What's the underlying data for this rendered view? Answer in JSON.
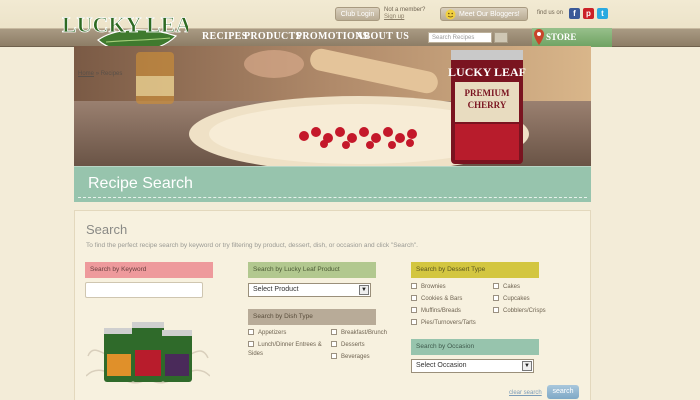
{
  "brand": {
    "logo_text": "LUCKY LEAF"
  },
  "header": {
    "club_login": "Club Login",
    "not_member": "Not a member?",
    "sign_up": "Sign up",
    "bloggers": "Meet Our Bloggers!",
    "find_us": "find us on"
  },
  "nav": {
    "items": [
      "RECIPES",
      "PRODUCTS",
      "PROMOTIONS",
      "ABOUT US"
    ],
    "search_placeholder": "Search Recipes",
    "store_locator": "STORE LOCATOR"
  },
  "hero": {
    "breadcrumb_home": "Home",
    "breadcrumb_sep": "»",
    "breadcrumb_current": "Recipes",
    "can_brand": "LUCKY LEAF",
    "can_label_1": "PREMIUM",
    "can_label_2": "CHERRY"
  },
  "page_title": "Recipe Search",
  "search": {
    "title": "Search",
    "intro": "To find the perfect recipe search by keyword or try filtering by product, dessert, dish, or occasion and click \"Search\".",
    "keyword": {
      "label": "Search by Keyword",
      "value": ""
    },
    "product": {
      "label": "Search by Lucky Leaf Product",
      "selected": "Select Product"
    },
    "dish": {
      "label": "Search by Dish Type",
      "col1": [
        "Appetizers",
        "Lunch/Dinner Entrees & Sides"
      ],
      "col2": [
        "Breakfast/Brunch",
        "Desserts",
        "Beverages"
      ]
    },
    "dessert": {
      "label": "Search by Dessert Type",
      "col1": [
        "Brownies",
        "Cookies & Bars",
        "Muffins/Breads",
        "Pies/Turnovers/Tarts"
      ],
      "col2": [
        "Cakes",
        "Cupcakes",
        "Cobblers/Crisps"
      ]
    },
    "occasion": {
      "label": "Search by Occasion",
      "selected": "Select Occasion"
    },
    "clear_label": "clear search",
    "submit_label": "search"
  },
  "colors": {
    "nav": "#9a8a72",
    "keyword_head": "#ee9a9c",
    "product_head": "#b2c88f",
    "dessert_head": "#d3c640",
    "dish_head": "#b8ab98",
    "occasion_head": "#97c4ad",
    "title_band": "#97c4ad"
  }
}
